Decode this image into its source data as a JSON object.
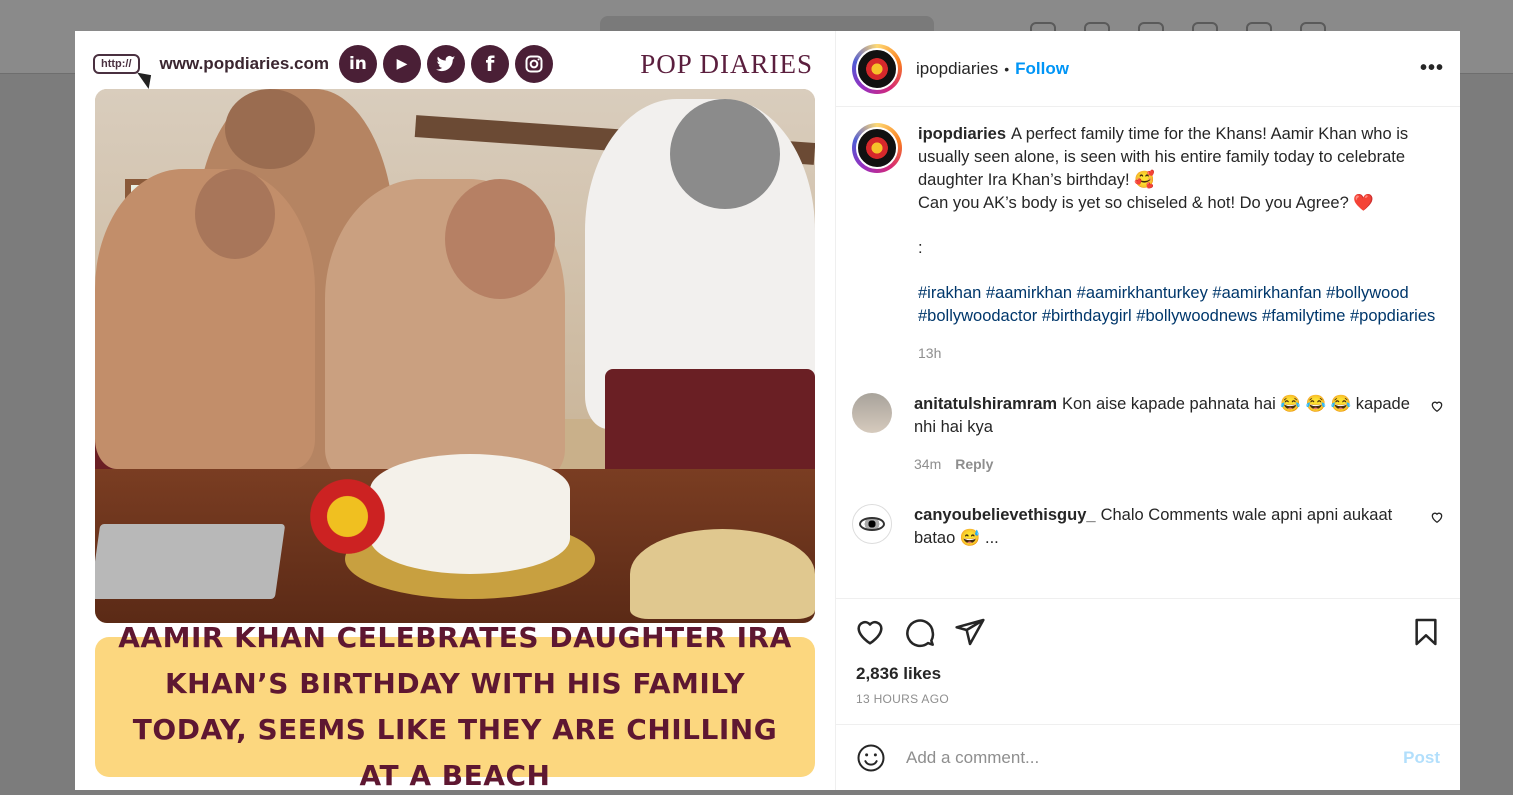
{
  "poster": {
    "url_tag": "http://",
    "site_url": "www.popdiaries.com",
    "social_icons": [
      {
        "icon": "linkedin-icon",
        "glyph": "in"
      },
      {
        "icon": "youtube-icon",
        "glyph": "▶"
      },
      {
        "icon": "twitter-icon",
        "glyph": "🐦"
      },
      {
        "icon": "facebook-icon",
        "glyph": "f"
      },
      {
        "icon": "instagram-icon",
        "glyph": "◎"
      }
    ],
    "brand": "POP DIARIES",
    "headline": "AAMIR KHAN CELEBRATES DAUGHTER IRA KHAN’S BIRTHDAY WITH HIS FAMILY TODAY, SEEMS LIKE THEY ARE CHILLING AT A BEACH",
    "headline_bg": "#fcd77f",
    "headline_color": "#5e1731"
  },
  "header": {
    "username": "ipopdiaries",
    "separator": "•",
    "follow_label": "Follow",
    "more_label": "•••"
  },
  "caption": {
    "username": "ipopdiaries",
    "text_line1": "A perfect family time for the Khans! Aamir Khan who is usually seen alone, is seen with his entire family today to celebrate daughter Ira Khan’s birthday! 🥰",
    "text_line2": "Can you AK’s body is yet so chiseled & hot! Do you Agree? ❤️",
    "text_line3": ":",
    "hashtags": "#irakhan #aamirkhan #aamirkhanturkey #aamirkhanfan #bollywood #bollywoodactor #birthdaygirl #bollywoodnews #familytime #popdiaries",
    "time": "13h"
  },
  "comments": [
    {
      "username": "anitatulshiramram",
      "text": "Kon aise kapade pahnata hai 😂 😂 😂 kapade nhi hai kya",
      "time": "34m",
      "reply_label": "Reply"
    },
    {
      "username": "canyoubelievethisguy_",
      "text": "Chalo Comments wale apni apni aukaat batao 😅 ..."
    }
  ],
  "likes": "2,836 likes",
  "posted_ago": "13 HOURS AGO",
  "add_comment": {
    "placeholder": "Add a comment...",
    "post_label": "Post"
  },
  "colors": {
    "accent": "#0095f6",
    "hashtag": "#00376b",
    "post_disabled": "#b2dffc"
  }
}
